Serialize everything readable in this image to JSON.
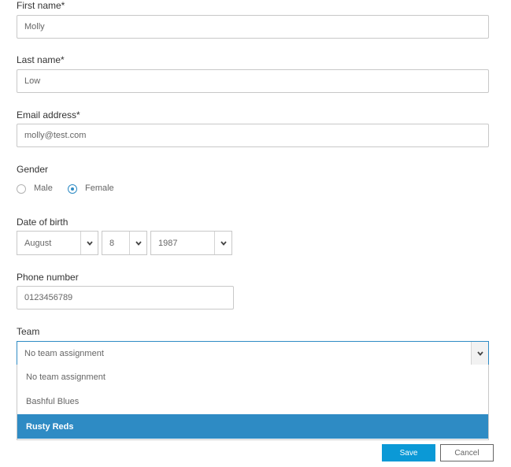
{
  "form": {
    "first_name": {
      "label": "First name*",
      "value": "Molly"
    },
    "last_name": {
      "label": "Last name*",
      "value": "Low"
    },
    "email": {
      "label": "Email address*",
      "value": "molly@test.com"
    },
    "gender": {
      "label": "Gender",
      "options": [
        {
          "label": "Male",
          "checked": false
        },
        {
          "label": "Female",
          "checked": true
        }
      ]
    },
    "dob": {
      "label": "Date of birth",
      "month": "August",
      "day": "8",
      "year": "1987"
    },
    "phone": {
      "label": "Phone number",
      "value": "0123456789"
    },
    "team": {
      "label": "Team",
      "selected": "No team assignment",
      "options": [
        "No team assignment",
        "Bashful Blues",
        "Rusty Reds"
      ],
      "highlighted_index": 2
    }
  },
  "actions": {
    "save_label": "Save",
    "cancel_label": "Cancel"
  },
  "colors": {
    "accent": "#2e8bc4",
    "save_button": "#0b99d6"
  },
  "icons": {
    "select_arrow": "chevron-down-icon"
  }
}
